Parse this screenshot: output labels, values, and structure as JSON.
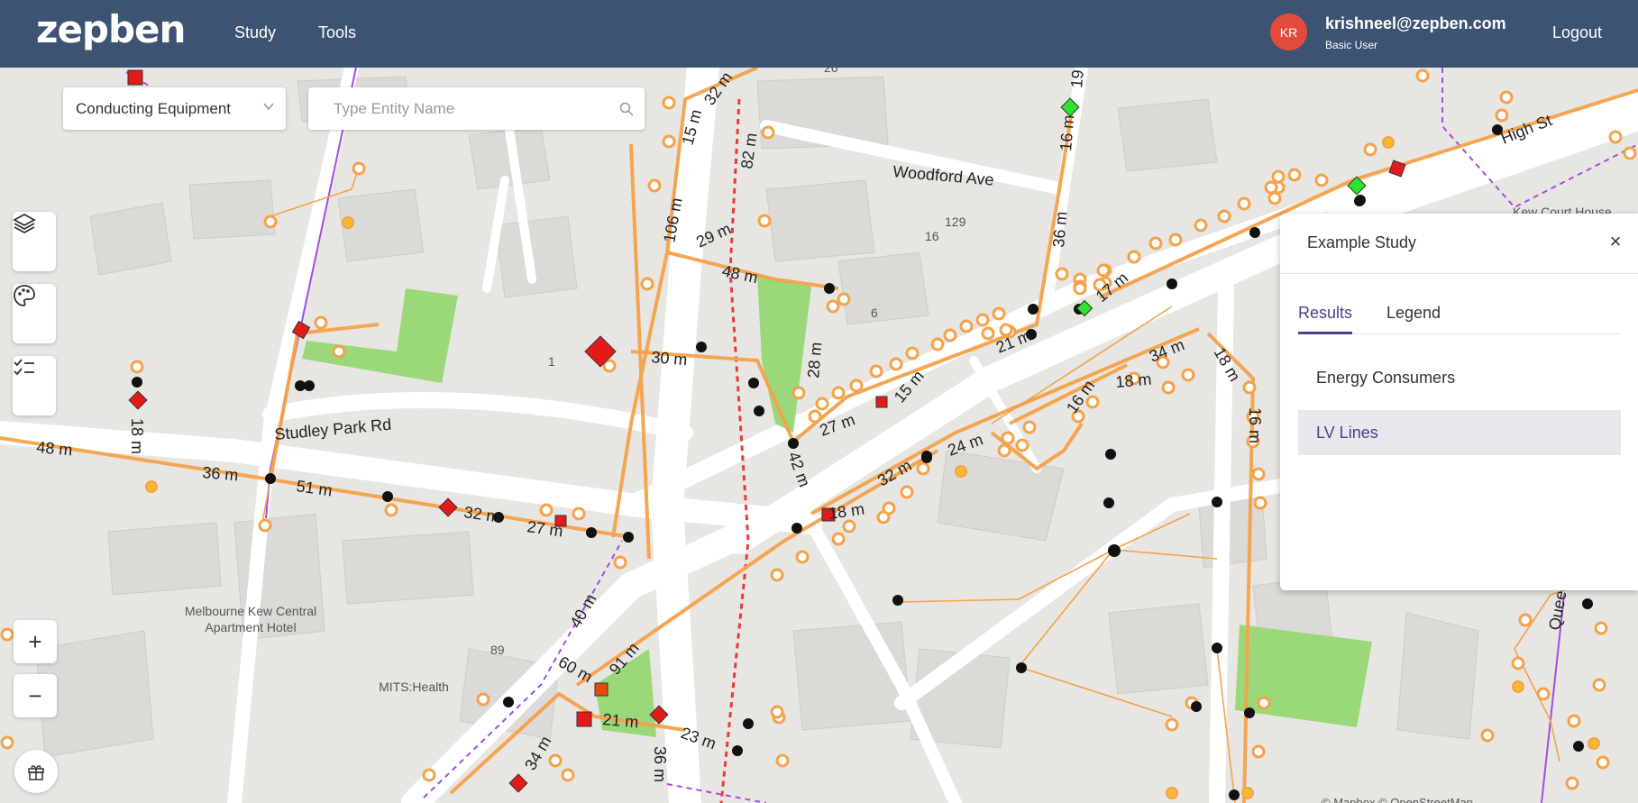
{
  "header": {
    "logo": "zepben",
    "nav": [
      "Study",
      "Tools"
    ],
    "avatar_initials": "KR",
    "user_email": "krishneel@zepben.com",
    "user_role": "Basic User",
    "logout": "Logout"
  },
  "filter": {
    "selected": "Conducting Equipment",
    "search_placeholder": "Type Entity Name"
  },
  "map": {
    "street_labels": [
      "Studley Park Rd",
      "Woodford Ave",
      "High St",
      "Queens"
    ],
    "poi_labels": [
      "Melbourne Kew Central",
      "Apartment Hotel",
      "MITS:Health",
      "Kew Court House"
    ],
    "house_numbers": [
      "26",
      "129",
      "16",
      "6",
      "1",
      "89"
    ],
    "distance_labels": [
      "48 m",
      "36 m",
      "51 m",
      "32 m",
      "27 m",
      "18 m",
      "30 m",
      "40 m",
      "60 m",
      "91 m",
      "21 m",
      "23 m",
      "34 m",
      "36 m",
      "42 m",
      "28 m",
      "48 m",
      "29 m",
      "106 m",
      "15 m",
      "82 m",
      "32 m",
      "16 m",
      "36 m",
      "19 m",
      "17 m",
      "21 m",
      "15 m",
      "27 m",
      "32 m",
      "24 m",
      "16 m",
      "18 m",
      "34 m",
      "18 m",
      "16 m",
      "18 m"
    ],
    "attribution": "© Mapbox © OpenStreetMap"
  },
  "study_panel": {
    "title": "Example Study",
    "tabs": [
      "Results",
      "Legend"
    ],
    "active_tab": "Results",
    "results": [
      "Energy Consumers",
      "LV Lines"
    ],
    "selected_result": "LV Lines"
  },
  "colors": {
    "header_bg": "#3c5472",
    "accent": "#4a3f8c",
    "line_orange": "#f5a24a",
    "avatar": "#e24b3b",
    "park": "#9ad87a"
  }
}
